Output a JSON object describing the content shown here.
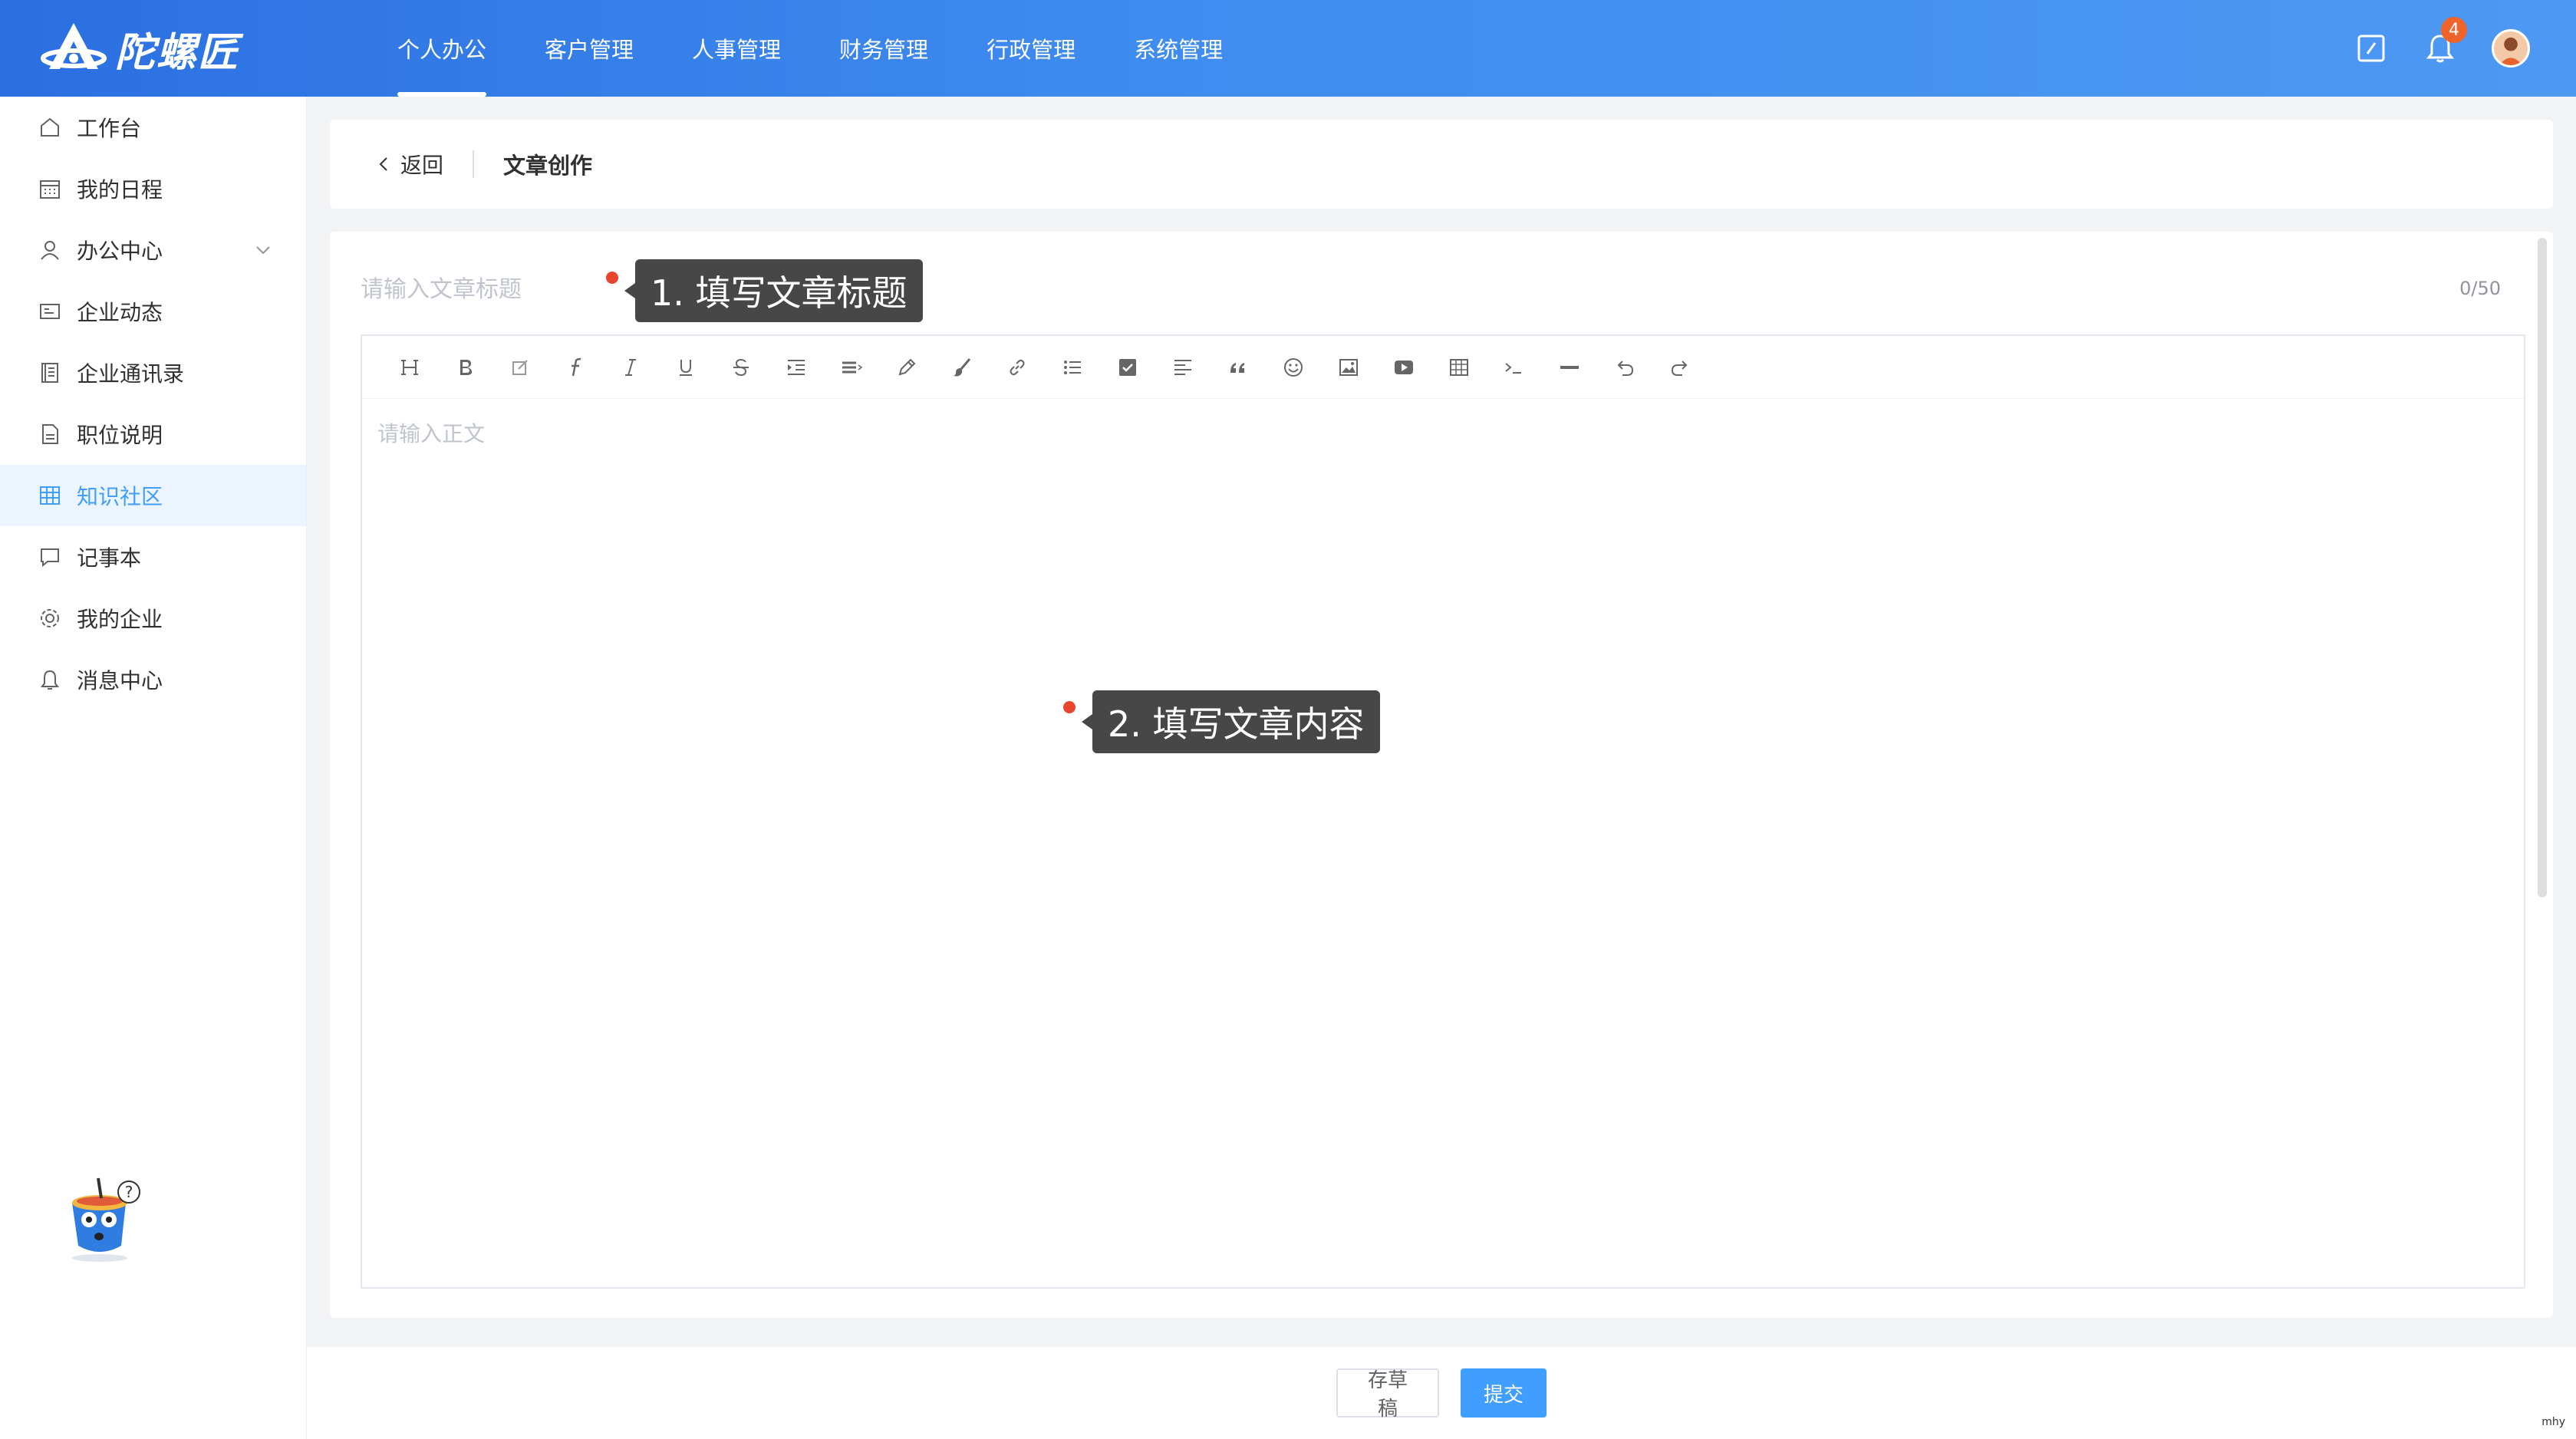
{
  "header": {
    "brand": "陀螺匠",
    "nav": [
      {
        "label": "个人办公",
        "active": true
      },
      {
        "label": "客户管理",
        "active": false
      },
      {
        "label": "人事管理",
        "active": false
      },
      {
        "label": "财务管理",
        "active": false
      },
      {
        "label": "行政管理",
        "active": false
      },
      {
        "label": "系统管理",
        "active": false
      }
    ],
    "notification_count": "4",
    "accent": "#3f8cf0"
  },
  "sidebar": {
    "items": [
      {
        "label": "工作台",
        "icon": "home-icon"
      },
      {
        "label": "我的日程",
        "icon": "calendar-icon"
      },
      {
        "label": "办公中心",
        "icon": "user-icon",
        "expandable": true
      },
      {
        "label": "企业动态",
        "icon": "news-icon"
      },
      {
        "label": "企业通讯录",
        "icon": "contacts-icon"
      },
      {
        "label": "职位说明",
        "icon": "document-icon"
      },
      {
        "label": "知识社区",
        "icon": "table-icon",
        "active": true
      },
      {
        "label": "记事本",
        "icon": "chat-icon"
      },
      {
        "label": "我的企业",
        "icon": "gear-icon"
      },
      {
        "label": "消息中心",
        "icon": "bell-icon"
      }
    ]
  },
  "page": {
    "back_label": "返回",
    "title": "文章创作"
  },
  "editor": {
    "title_placeholder": "请输入文章标题",
    "title_counter": "0/50",
    "body_placeholder": "请输入正文",
    "toolbar": [
      "heading-icon",
      "bold-icon",
      "edit-icon",
      "font-icon",
      "italic-icon",
      "underline-icon",
      "strikethrough-icon",
      "indent-icon",
      "align-icon",
      "pen-icon",
      "brush-icon",
      "link-icon",
      "list-icon",
      "checkbox-icon",
      "align-left-icon",
      "quote-icon",
      "emoji-icon",
      "image-icon",
      "video-icon",
      "table-icon",
      "code-icon",
      "hr-icon",
      "undo-icon",
      "redo-icon"
    ]
  },
  "tips": {
    "title_tip": "1. 填写文章标题",
    "body_tip": "2. 填写文章内容"
  },
  "footer": {
    "draft_label": "存草稿",
    "submit_label": "提交"
  },
  "watermark": "mhy"
}
